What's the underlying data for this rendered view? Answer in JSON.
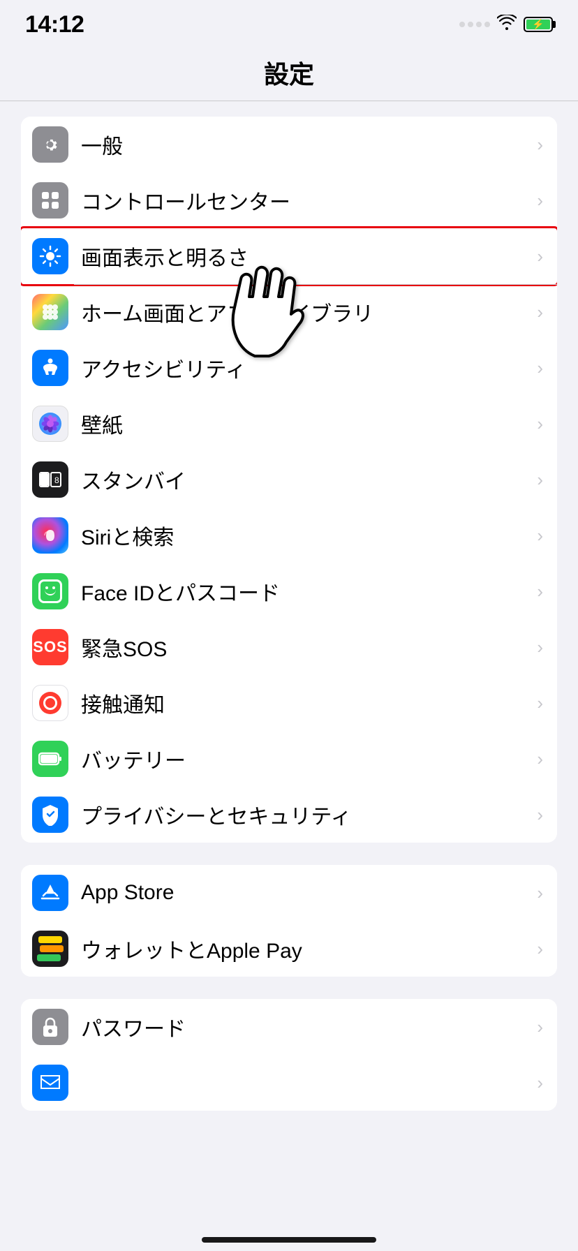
{
  "statusBar": {
    "time": "14:12"
  },
  "pageTitle": "設定",
  "section1": {
    "rows": [
      {
        "id": "general",
        "label": "一般",
        "iconType": "gray",
        "iconName": "gear"
      },
      {
        "id": "control-center",
        "label": "コントロールセンター",
        "iconType": "gray2",
        "iconName": "switches"
      },
      {
        "id": "display",
        "label": "画面表示と明るさ",
        "iconType": "blue",
        "iconName": "sun",
        "highlighted": true
      },
      {
        "id": "home-screen",
        "label": "ホーム画面とアプリライブラリ",
        "iconType": "colorful",
        "iconName": "dots"
      },
      {
        "id": "accessibility",
        "label": "アクセシビリティ",
        "iconType": "blue2",
        "iconName": "accessibility"
      },
      {
        "id": "wallpaper",
        "label": "壁紙",
        "iconType": "flower",
        "iconName": "flower"
      },
      {
        "id": "standby",
        "label": "スタンバイ",
        "iconType": "black",
        "iconName": "standby"
      },
      {
        "id": "siri",
        "label": "Siriと検索",
        "iconType": "siri",
        "iconName": "siri"
      },
      {
        "id": "faceid",
        "label": "Face IDとパスコード",
        "iconType": "faceid",
        "iconName": "faceid"
      },
      {
        "id": "sos",
        "label": "緊急SOS",
        "iconType": "sos",
        "iconName": "sos"
      },
      {
        "id": "contact-tracing",
        "label": "接触通知",
        "iconType": "contact",
        "iconName": "contact"
      },
      {
        "id": "battery",
        "label": "バッテリー",
        "iconType": "battery2",
        "iconName": "battery"
      },
      {
        "id": "privacy",
        "label": "プライバシーとセキュリティ",
        "iconType": "privacy",
        "iconName": "hand"
      }
    ]
  },
  "section2": {
    "rows": [
      {
        "id": "appstore",
        "label": "App Store",
        "iconType": "appstore",
        "iconName": "appstore"
      },
      {
        "id": "wallet",
        "label": "ウォレットとApple Pay",
        "iconType": "wallet",
        "iconName": "wallet"
      }
    ]
  },
  "section3": {
    "rows": [
      {
        "id": "passwords",
        "label": "パスワード",
        "iconType": "password2",
        "iconName": "key"
      },
      {
        "id": "bottom",
        "label": "",
        "iconType": "blue3",
        "iconName": "mail"
      }
    ]
  }
}
